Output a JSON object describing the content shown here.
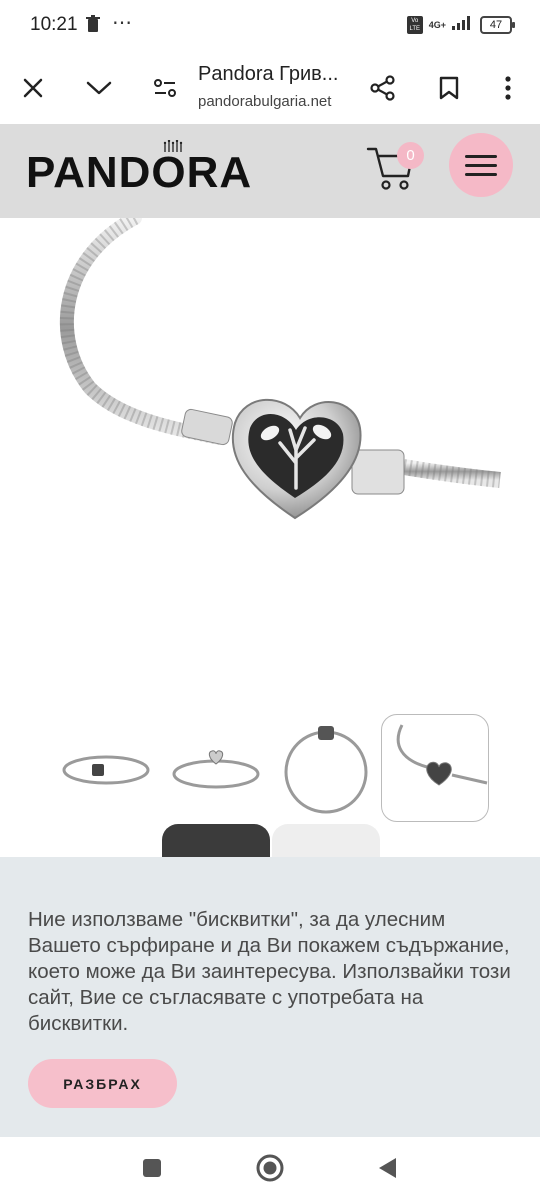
{
  "status_bar": {
    "time": "10:21",
    "network": "4G+",
    "volte": "Vo LTE",
    "battery": "47",
    "icons": [
      "trash-icon",
      "more-icon",
      "signal-icon",
      "battery-icon"
    ]
  },
  "browser": {
    "page_title": "Pandora Грив...",
    "url": "pandorabulgaria.net",
    "icons": [
      "close-icon",
      "chevron-down-icon",
      "page-settings-icon",
      "share-icon",
      "bookmark-icon",
      "more-vertical-icon"
    ]
  },
  "site": {
    "logo": "PANDORA",
    "cart_count": "0",
    "accent_color": "#f5b9c7",
    "header_bg": "#dcdcdc"
  },
  "gallery": {
    "thumbnail_count": 4,
    "active_thumbnail": 4
  },
  "cookie_banner": {
    "text": "Ние използваме \"бисквитки\", за да улесним Вашето сърфиране и да Ви покажем съдържание, което може да Ви заинтересува. Използвайки този сайт, Вие се съгласявате с употребата на бисквитки.",
    "accept_label": "РАЗБРАХ",
    "bg_color": "#e4e9ec"
  },
  "nav_bar": {
    "icons": [
      "recents-icon",
      "home-icon",
      "back-icon"
    ]
  }
}
